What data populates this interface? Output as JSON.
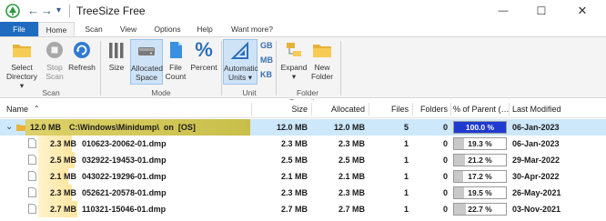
{
  "window": {
    "title": "TreeSize Free",
    "quick_access": {
      "back": "←",
      "forward": "→",
      "dropdown": "▾"
    },
    "controls": {
      "minimize": "—",
      "maximize": "☐",
      "close": "✕"
    }
  },
  "ribbon_tabs": [
    "File",
    "Home",
    "Scan",
    "View",
    "Options",
    "Help",
    "Want more?"
  ],
  "ribbon": {
    "scan_group": {
      "label": "Scan",
      "select_directory": [
        "Select",
        "Directory ▾"
      ],
      "stop_scan": [
        "Stop",
        "Scan"
      ],
      "refresh": "Refresh"
    },
    "mode_group": {
      "label": "Mode",
      "size": "Size",
      "allocated_space": [
        "Allocated",
        "Space"
      ],
      "file_count": [
        "File",
        "Count"
      ],
      "percent": "Percent"
    },
    "unit_group": {
      "label": "Unit",
      "gb": "GB",
      "mb": "MB",
      "kb": "KB",
      "automatic_units": [
        "Automatic",
        "Units ▾"
      ]
    },
    "folder_ops_group": {
      "label": "Folder Operations",
      "expand": [
        "Expand",
        "▾"
      ],
      "new_folder": [
        "New",
        "Folder"
      ]
    }
  },
  "columns": [
    "Name",
    "Size",
    "Allocated",
    "Files",
    "Folders",
    "% of Parent (…",
    "Last Modified"
  ],
  "root": {
    "size_label": "12.0 MB",
    "path": "C:\\Windows\\Minidump\\  on  [OS]",
    "size": "12.0 MB",
    "allocated": "12.0 MB",
    "files": "5",
    "folders": "0",
    "percent_text": "100.0 %",
    "percent": 100,
    "modified": "06-Jan-2023"
  },
  "files": [
    {
      "size_label": "2.3 MB",
      "name": "010623-20062-01.dmp",
      "size": "2.3 MB",
      "allocated": "2.3 MB",
      "files": "1",
      "folders": "0",
      "percent_text": "19.3 %",
      "percent": 19.3,
      "modified": "06-Jan-2023"
    },
    {
      "size_label": "2.5 MB",
      "name": "032922-19453-01.dmp",
      "size": "2.5 MB",
      "allocated": "2.5 MB",
      "files": "1",
      "folders": "0",
      "percent_text": "21.2 %",
      "percent": 21.2,
      "modified": "29-Mar-2022"
    },
    {
      "size_label": "2.1 MB",
      "name": "043022-19296-01.dmp",
      "size": "2.1 MB",
      "allocated": "2.1 MB",
      "files": "1",
      "folders": "0",
      "percent_text": "17.2 %",
      "percent": 17.2,
      "modified": "30-Apr-2022"
    },
    {
      "size_label": "2.3 MB",
      "name": "052621-20578-01.dmp",
      "size": "2.3 MB",
      "allocated": "2.3 MB",
      "files": "1",
      "folders": "0",
      "percent_text": "19.5 %",
      "percent": 19.5,
      "modified": "26-May-2021"
    },
    {
      "size_label": "2.7 MB",
      "name": "110321-15046-01.dmp",
      "size": "2.7 MB",
      "allocated": "2.7 MB",
      "files": "1",
      "folders": "0",
      "percent_text": "22.7 %",
      "percent": 22.7,
      "modified": "03-Nov-2021"
    }
  ],
  "colors": {
    "accent": "#1f6bbf",
    "selection": "#cde7fb",
    "root_bar": "#c8bf4a",
    "file_bar": "#ffe9a8",
    "percent_full": "#1f3ad0"
  }
}
